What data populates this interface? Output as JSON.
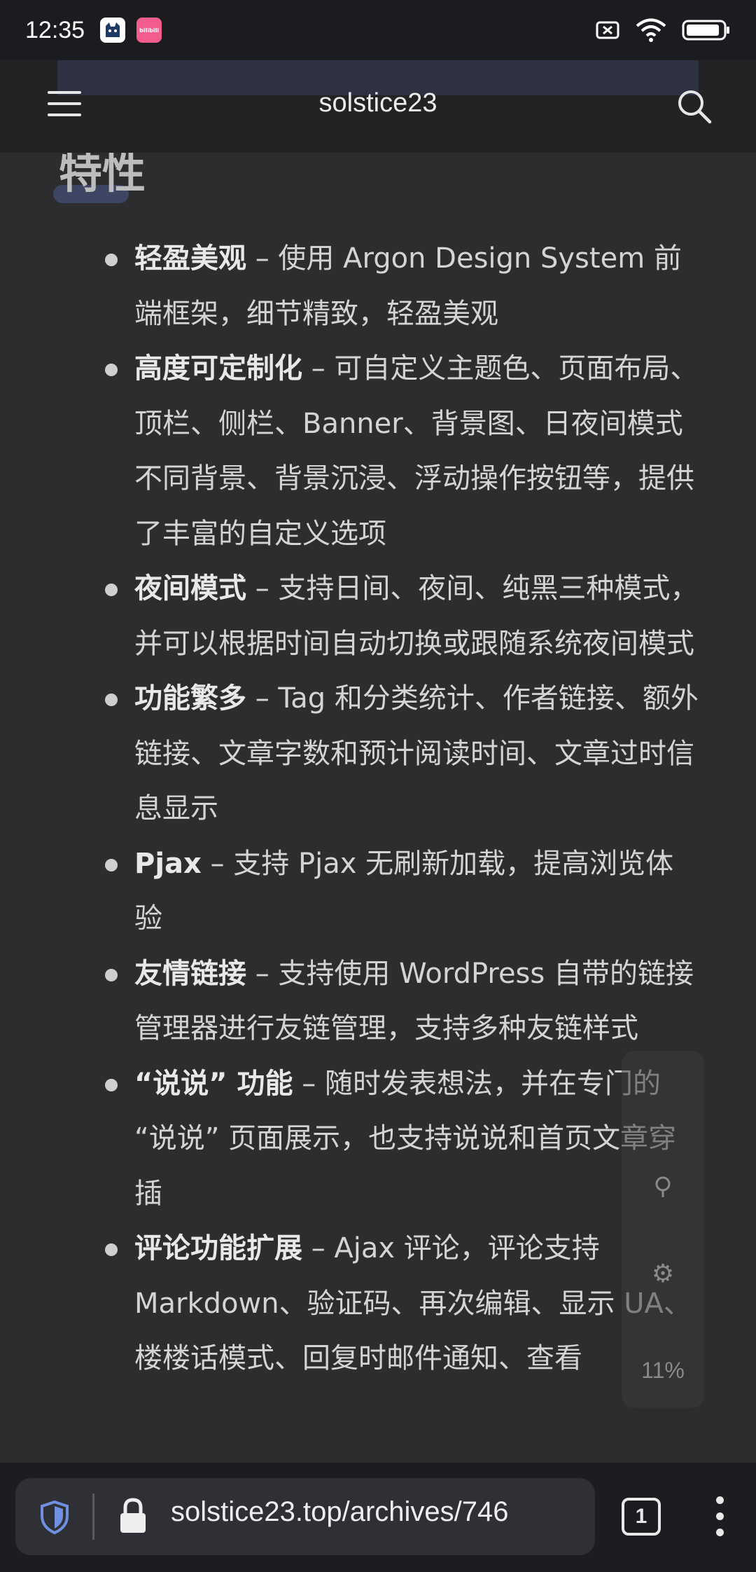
{
  "status_bar": {
    "time": "12:35",
    "app_badges": [
      "cat-app-icon",
      "bilibili-icon"
    ],
    "bilibili_badge_text": "bilibili",
    "right_icons": [
      "no-sim-icon",
      "wifi-icon",
      "battery-icon"
    ]
  },
  "header": {
    "title": "solstice23",
    "menu_icon": "menu-icon",
    "search_icon": "search-icon"
  },
  "section": {
    "heading": "特性"
  },
  "features": [
    {
      "title": "轻盈美观",
      "desc": " – 使用 Argon Design System 前端框架，细节精致，轻盈美观"
    },
    {
      "title": "高度可定制化",
      "desc": " – 可自定义主题色、页面布局、顶栏、侧栏、Banner、背景图、日夜间模式不同背景、背景沉浸、浮动操作按钮等，提供了丰富的自定义选项"
    },
    {
      "title": "夜间模式",
      "desc": " – 支持日间、夜间、纯黑三种模式，并可以根据时间自动切换或跟随系统夜间模式"
    },
    {
      "title": "功能繁多",
      "desc": " – Tag 和分类统计、作者链接、额外链接、文章字数和预计阅读时间、文章过时信息显示"
    },
    {
      "title": "Pjax",
      "desc": " – 支持 Pjax 无刷新加载，提高浏览体验"
    },
    {
      "title": "友情链接",
      "desc": " – 支持使用 WordPress 自带的链接管理器进行友链管理，支持多种友链样式"
    },
    {
      "title": "“说说” 功能",
      "desc": " – 随时发表想法，并在专门的 “说说” 页面展示，也支持说说和首页文章穿插"
    },
    {
      "title": "评论功能扩展",
      "desc": " – Ajax 评论，评论支持 Markdown、验证码、再次编辑、显示 UA、楼楼话模式、回复时邮件通知、查看"
    }
  ],
  "floating_actions": {
    "button1_icon": "settings-toggle-icon",
    "button2_icon": "gear-icon",
    "progress_text": "11%"
  },
  "browser_bar": {
    "url": "solstice23.top/archives/746",
    "tab_count": "1",
    "shield_icon": "shield-icon",
    "lock_icon": "lock-icon",
    "more_icon": "more-vert-icon"
  },
  "colors": {
    "background": "#2d2d2f",
    "status_bar": "#1b1c1f",
    "header": "#232325",
    "shield_accent": "#6f8fe0",
    "bilibili_pink": "#f25d8e"
  }
}
